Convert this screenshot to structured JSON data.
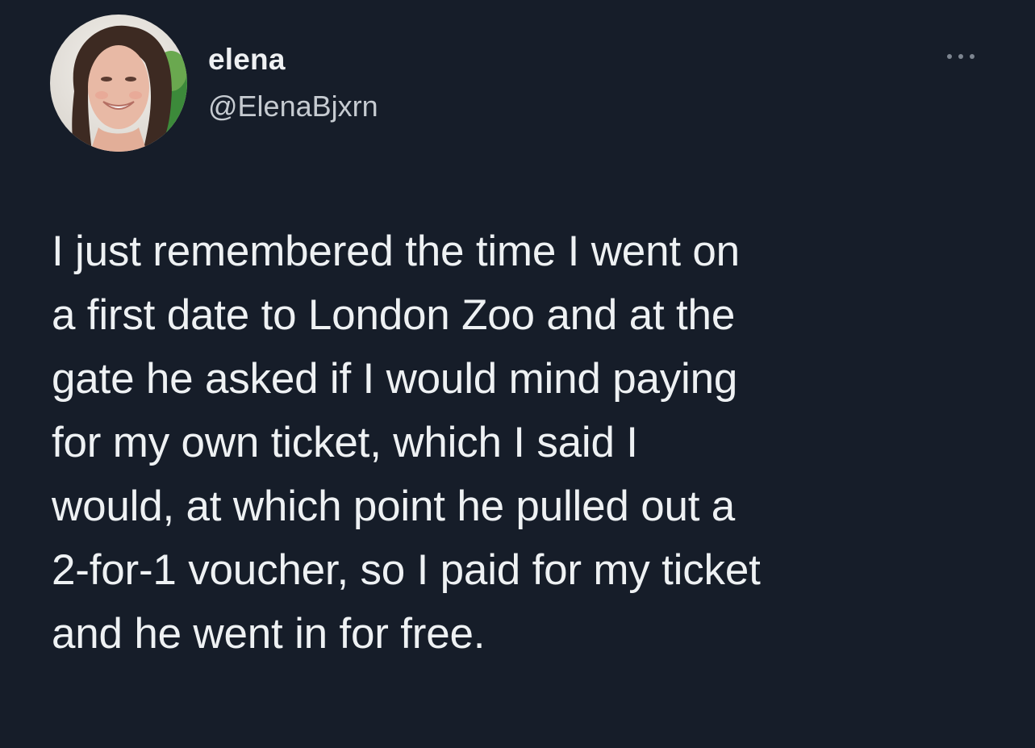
{
  "author": {
    "display_name": "elena",
    "handle": "@ElenaBjxrn",
    "avatar_icon": "profile-photo"
  },
  "menu": {
    "more_icon": "more-horizontal-icon"
  },
  "tweet": {
    "text": "I just remembered the time I went on\na first date to London Zoo and at the\ngate he asked if I would mind paying\nfor my own ticket, which I said I\nwould, at which point he pulled out a\n2-for-1 voucher, so I paid for my ticket\nand he went in for free."
  },
  "colors": {
    "background": "#161d29",
    "text": "#eef1f3",
    "secondary_text": "#c6cbd1"
  }
}
